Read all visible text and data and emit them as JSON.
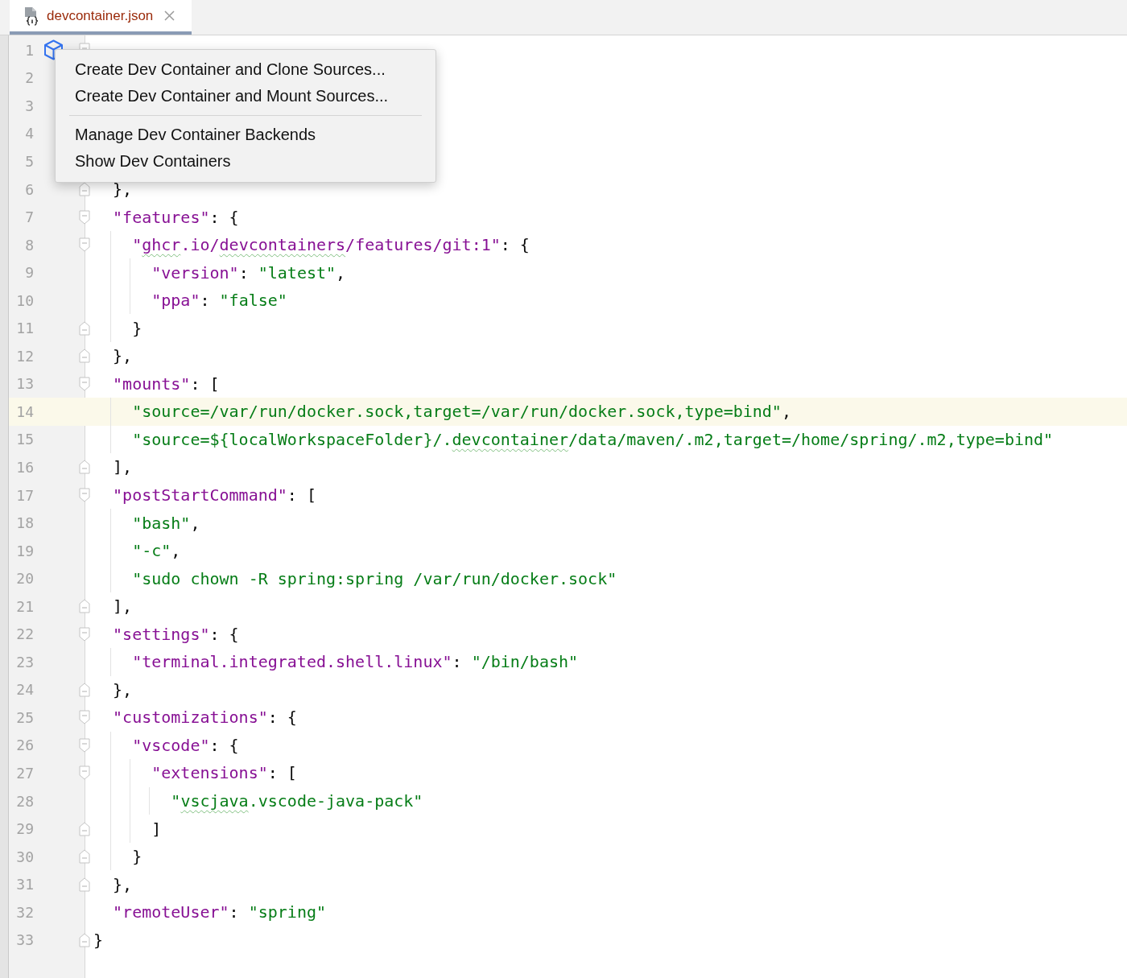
{
  "tab": {
    "title": "devcontainer.json",
    "selected": true
  },
  "lines": [
    {
      "number": "1",
      "fold_start": true,
      "gutter_icon": true,
      "current": false
    },
    {
      "number": "2",
      "current": false
    },
    {
      "number": "3",
      "current": false
    },
    {
      "number": "4",
      "current": false
    },
    {
      "number": "5",
      "current": false
    },
    {
      "number": "6",
      "fold_start": false,
      "current": false,
      "code": [
        {
          "kind": "punct",
          "text": "  },"
        }
      ]
    },
    {
      "number": "7",
      "fold_start": true,
      "current": false,
      "code": [
        {
          "kind": "key",
          "text": "  \"features\""
        },
        {
          "kind": "punct",
          "text": ": {"
        }
      ]
    },
    {
      "number": "8",
      "fold_start": true,
      "current": false,
      "code": [
        {
          "kind": "key",
          "text": "    \""
        },
        {
          "kind": "key",
          "text": "ghcr",
          "typo": true
        },
        {
          "kind": "key",
          "text": ".io/"
        },
        {
          "kind": "key",
          "text": "devcontainers",
          "typo": true
        },
        {
          "kind": "key",
          "text": "/features/git:1\""
        },
        {
          "kind": "punct",
          "text": ": {"
        }
      ]
    },
    {
      "number": "9",
      "current": false,
      "code": [
        {
          "kind": "key",
          "text": "      \"version\""
        },
        {
          "kind": "punct",
          "text": ": "
        },
        {
          "kind": "string",
          "text": "\"latest\""
        },
        {
          "kind": "punct",
          "text": ","
        }
      ]
    },
    {
      "number": "10",
      "current": false,
      "code": [
        {
          "kind": "key",
          "text": "      \"ppa\""
        },
        {
          "kind": "punct",
          "text": ": "
        },
        {
          "kind": "string",
          "text": "\"false\""
        }
      ]
    },
    {
      "number": "11",
      "fold_start": false,
      "current": false,
      "code": [
        {
          "kind": "punct",
          "text": "    }"
        }
      ]
    },
    {
      "number": "12",
      "fold_start": false,
      "current": false,
      "code": [
        {
          "kind": "punct",
          "text": "  },"
        }
      ]
    },
    {
      "number": "13",
      "fold_start": true,
      "current": false,
      "code": [
        {
          "kind": "key",
          "text": "  \"mounts\""
        },
        {
          "kind": "punct",
          "text": ": ["
        }
      ]
    },
    {
      "number": "14",
      "current": true,
      "code": [
        {
          "kind": "string",
          "text": "    \"source=/var/run/docker.sock,target=/var/run/docker.sock,type=bind\""
        },
        {
          "kind": "punct",
          "text": ","
        }
      ]
    },
    {
      "number": "15",
      "current": false,
      "code": [
        {
          "kind": "string",
          "text": "    \"source=${localWorkspaceFolder}/."
        },
        {
          "kind": "string",
          "text": "devcontainer",
          "typo": true
        },
        {
          "kind": "string",
          "text": "/data/maven/.m2,target=/home/spring/.m2,type=bind\""
        }
      ]
    },
    {
      "number": "16",
      "fold_start": false,
      "current": false,
      "code": [
        {
          "kind": "punct",
          "text": "  ],"
        }
      ]
    },
    {
      "number": "17",
      "fold_start": true,
      "current": false,
      "code": [
        {
          "kind": "key",
          "text": "  \"postStartCommand\""
        },
        {
          "kind": "punct",
          "text": ": ["
        }
      ]
    },
    {
      "number": "18",
      "current": false,
      "code": [
        {
          "kind": "string",
          "text": "    \"bash\""
        },
        {
          "kind": "punct",
          "text": ","
        }
      ]
    },
    {
      "number": "19",
      "current": false,
      "code": [
        {
          "kind": "string",
          "text": "    \"-c\""
        },
        {
          "kind": "punct",
          "text": ","
        }
      ]
    },
    {
      "number": "20",
      "current": false,
      "code": [
        {
          "kind": "string",
          "text": "    \"sudo chown -R spring:spring /var/run/docker.sock\""
        }
      ]
    },
    {
      "number": "21",
      "fold_start": false,
      "current": false,
      "code": [
        {
          "kind": "punct",
          "text": "  ],"
        }
      ]
    },
    {
      "number": "22",
      "fold_start": true,
      "current": false,
      "code": [
        {
          "kind": "key",
          "text": "  \"settings\""
        },
        {
          "kind": "punct",
          "text": ": {"
        }
      ]
    },
    {
      "number": "23",
      "current": false,
      "code": [
        {
          "kind": "key",
          "text": "    \"terminal.integrated.shell.linux\""
        },
        {
          "kind": "punct",
          "text": ": "
        },
        {
          "kind": "string",
          "text": "\"/bin/bash\""
        }
      ]
    },
    {
      "number": "24",
      "fold_start": false,
      "current": false,
      "code": [
        {
          "kind": "punct",
          "text": "  },"
        }
      ]
    },
    {
      "number": "25",
      "fold_start": true,
      "current": false,
      "code": [
        {
          "kind": "key",
          "text": "  \"customizations\""
        },
        {
          "kind": "punct",
          "text": ": {"
        }
      ]
    },
    {
      "number": "26",
      "fold_start": true,
      "current": false,
      "code": [
        {
          "kind": "key",
          "text": "    \"vscode\""
        },
        {
          "kind": "punct",
          "text": ": {"
        }
      ]
    },
    {
      "number": "27",
      "fold_start": true,
      "current": false,
      "code": [
        {
          "kind": "key",
          "text": "      \"extensions\""
        },
        {
          "kind": "punct",
          "text": ": ["
        }
      ]
    },
    {
      "number": "28",
      "current": false,
      "code": [
        {
          "kind": "string",
          "text": "        \""
        },
        {
          "kind": "string",
          "text": "vscjava",
          "typo": true
        },
        {
          "kind": "string",
          "text": ".vscode-java-pack\""
        }
      ]
    },
    {
      "number": "29",
      "fold_start": false,
      "current": false,
      "code": [
        {
          "kind": "punct",
          "text": "      ]"
        }
      ]
    },
    {
      "number": "30",
      "fold_start": false,
      "current": false,
      "code": [
        {
          "kind": "punct",
          "text": "    }"
        }
      ]
    },
    {
      "number": "31",
      "fold_start": false,
      "current": false,
      "code": [
        {
          "kind": "punct",
          "text": "  },"
        }
      ]
    },
    {
      "number": "32",
      "current": false,
      "code": [
        {
          "kind": "key",
          "text": "  \"remoteUser\""
        },
        {
          "kind": "punct",
          "text": ": "
        },
        {
          "kind": "string",
          "text": "\"spring\""
        }
      ]
    },
    {
      "number": "33",
      "fold_start": false,
      "current": false,
      "code": [
        {
          "kind": "punct",
          "text": "}"
        }
      ]
    }
  ],
  "menu": {
    "groups": [
      [
        "Create Dev Container and Clone Sources...",
        "Create Dev Container and Mount Sources..."
      ],
      [
        "Manage Dev Container Backends",
        "Show Dev Containers"
      ]
    ]
  }
}
